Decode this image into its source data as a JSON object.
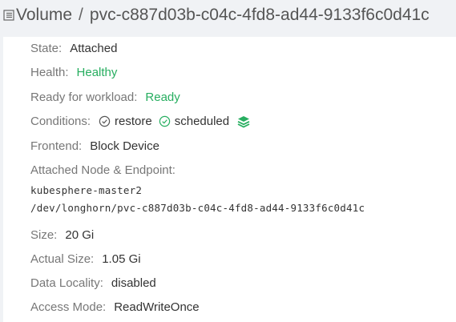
{
  "header": {
    "section": "Volume",
    "separator": "/",
    "volume_name": "pvc-c887d03b-c04c-4fd8-ad44-9133f6c0d41c"
  },
  "details": {
    "state_label": "State:",
    "state_value": "Attached",
    "health_label": "Health:",
    "health_value": "Healthy",
    "ready_label": "Ready for workload:",
    "ready_value": "Ready",
    "conditions_label": "Conditions:",
    "conditions": [
      {
        "label": "restore",
        "icon": "check-circle-icon",
        "color": "#555555"
      },
      {
        "label": "scheduled",
        "icon": "check-circle-icon",
        "color": "#27ae60"
      }
    ],
    "frontend_label": "Frontend:",
    "frontend_value": "Block Device",
    "endpoint_label": "Attached Node & Endpoint:",
    "endpoint_node": "kubesphere-master2",
    "endpoint_path": "/dev/longhorn/pvc-c887d03b-c04c-4fd8-ad44-9133f6c0d41c",
    "size_label": "Size:",
    "size_value": "20 Gi",
    "actual_size_label": "Actual Size:",
    "actual_size_value": "1.05 Gi",
    "locality_label": "Data Locality:",
    "locality_value": "disabled",
    "access_label": "Access Mode:",
    "access_value": "ReadWriteOnce"
  },
  "colors": {
    "healthy": "#27ae60",
    "label": "#777777",
    "value": "#333333"
  }
}
